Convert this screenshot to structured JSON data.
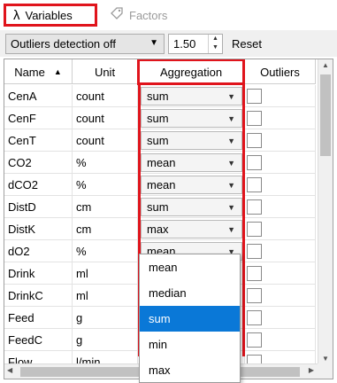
{
  "tabs": [
    {
      "label": "Variables",
      "icon": "lambda-icon",
      "active": true
    },
    {
      "label": "Factors",
      "icon": "tag-icon",
      "active": false
    }
  ],
  "toolbar": {
    "outliers_mode": "Outliers detection off",
    "threshold": "1.50",
    "reset_label": "Reset"
  },
  "table": {
    "headers": {
      "name": "Name",
      "unit": "Unit",
      "aggregation": "Aggregation",
      "outliers": "Outliers"
    },
    "rows": [
      {
        "name": "CenA",
        "unit": "count",
        "agg": "sum"
      },
      {
        "name": "CenF",
        "unit": "count",
        "agg": "sum"
      },
      {
        "name": "CenT",
        "unit": "count",
        "agg": "sum"
      },
      {
        "name": "CO2",
        "unit": "%",
        "agg": "mean"
      },
      {
        "name": "dCO2",
        "unit": "%",
        "agg": "mean"
      },
      {
        "name": "DistD",
        "unit": "cm",
        "agg": "sum"
      },
      {
        "name": "DistK",
        "unit": "cm",
        "agg": "max"
      },
      {
        "name": "dO2",
        "unit": "%",
        "agg": "mean"
      },
      {
        "name": "Drink",
        "unit": "ml",
        "agg": ""
      },
      {
        "name": "DrinkC",
        "unit": "ml",
        "agg": ""
      },
      {
        "name": "Feed",
        "unit": "g",
        "agg": ""
      },
      {
        "name": "FeedC",
        "unit": "g",
        "agg": ""
      },
      {
        "name": "Flow",
        "unit": "l/min",
        "agg": ""
      }
    ]
  },
  "dropdown": {
    "options": [
      "mean",
      "median",
      "sum",
      "min",
      "max"
    ],
    "selected": "sum"
  },
  "colors": {
    "highlight": "#e0141c",
    "selection": "#0a78d7"
  }
}
